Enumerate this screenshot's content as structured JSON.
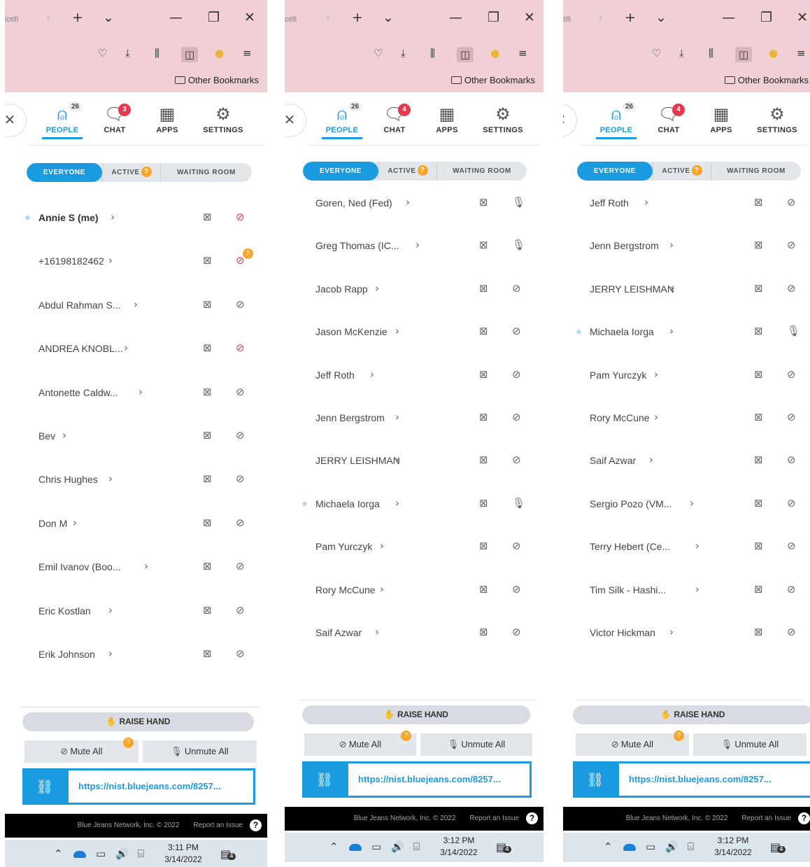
{
  "browser": {
    "tab_fragments": [
      "lotifi",
      "otifi",
      "tifi"
    ],
    "bookmarks_label": "Other Bookmarks",
    "icons": {
      "forward": "chevron-right-icon",
      "new_tab": "plus-icon",
      "list_tabs": "chevron-down-icon",
      "minimize": "minimize-icon",
      "restore": "restore-icon",
      "close": "close-icon",
      "pocket": "pocket-icon",
      "download": "download-icon",
      "library": "library-icon",
      "sidebar": "sidebar-icon",
      "profile": "profile-icon",
      "menu": "hamburger-icon",
      "folder": "folder-icon"
    }
  },
  "tabs": {
    "people": "PEOPLE",
    "chat": "CHAT",
    "apps": "APPS",
    "settings": "SETTINGS",
    "people_count": "26"
  },
  "filters": {
    "everyone": "EVERYONE",
    "active": "ACTIVE",
    "active_badge": "?",
    "waiting": "WAITING ROOM"
  },
  "controls": {
    "raise_hand": "RAISE HAND",
    "mute_all": "Mute All",
    "unmute_all": "Unmute All",
    "mute_badge": "?",
    "meeting_url": "https://nist.bluejeans.com/8257..."
  },
  "footer": {
    "copyright": "Blue Jeans Network, Inc. © 2022",
    "report": "Report an Issue",
    "help": "?"
  },
  "colors": {
    "accent": "#1a9be0",
    "browser_chrome": "#f0d0d5",
    "alert": "#e63950",
    "warning": "#f7a52b"
  },
  "panels": [
    {
      "chat_badge": "3",
      "clock_time": "3:11 PM",
      "clock_date": "3/14/2022",
      "notifications": "4",
      "participants": [
        {
          "name": "Annie S (me)",
          "bold": true,
          "star": true,
          "mic": "muted-red"
        },
        {
          "name": "+16198182462",
          "mic": "muted-red-warning"
        },
        {
          "name": "Abdul Rahman S...",
          "mic": "muted"
        },
        {
          "name": "ANDREA KNOBL...",
          "mic": "muted-red"
        },
        {
          "name": "Antonette Caldw...",
          "mic": "muted"
        },
        {
          "name": "Bev",
          "mic": "muted"
        },
        {
          "name": "Chris Hughes",
          "mic": "muted"
        },
        {
          "name": "Don M",
          "mic": "muted"
        },
        {
          "name": "Emil Ivanov (Boo...",
          "mic": "muted"
        },
        {
          "name": "Eric Kostlan",
          "mic": "muted"
        },
        {
          "name": "Erik Johnson",
          "mic": "muted"
        }
      ]
    },
    {
      "chat_badge": "4",
      "clock_time": "3:12 PM",
      "clock_date": "3/14/2022",
      "notifications": "4",
      "participants": [
        {
          "name": "Goren, Ned (Fed)",
          "mic": "on"
        },
        {
          "name": "Greg Thomas (IC...",
          "mic": "on"
        },
        {
          "name": "Jacob Rapp",
          "mic": "muted"
        },
        {
          "name": "Jason McKenzie",
          "mic": "muted"
        },
        {
          "name": "Jeff Roth",
          "mic": "muted"
        },
        {
          "name": "Jenn Bergstrom",
          "mic": "muted"
        },
        {
          "name": "JERRY LEISHMAN",
          "mic": "muted"
        },
        {
          "name": "Michaela Iorga",
          "star": true,
          "mic": "on"
        },
        {
          "name": "Pam Yurczyk",
          "mic": "muted"
        },
        {
          "name": "Rory McCune",
          "mic": "muted"
        },
        {
          "name": "Saif Azwar",
          "mic": "muted"
        }
      ]
    },
    {
      "chat_badge": "4",
      "clock_time": "3:12 PM",
      "clock_date": "3/14/2022",
      "notifications": "4",
      "participants": [
        {
          "name": "Jeff Roth",
          "mic": "muted"
        },
        {
          "name": "Jenn Bergstrom",
          "mic": "muted"
        },
        {
          "name": "JERRY LEISHMAN",
          "mic": "muted"
        },
        {
          "name": "Michaela Iorga",
          "star": true,
          "mic": "on"
        },
        {
          "name": "Pam Yurczyk",
          "mic": "muted"
        },
        {
          "name": "Rory McCune",
          "mic": "muted"
        },
        {
          "name": "Saif Azwar",
          "mic": "muted"
        },
        {
          "name": "Sergio Pozo (VM...",
          "mic": "muted"
        },
        {
          "name": "Terry Hebert (Ce...",
          "mic": "muted"
        },
        {
          "name": "Tim Silk - Hashi...",
          "mic": "muted"
        },
        {
          "name": "Victor Hickman",
          "mic": "muted"
        }
      ]
    }
  ]
}
